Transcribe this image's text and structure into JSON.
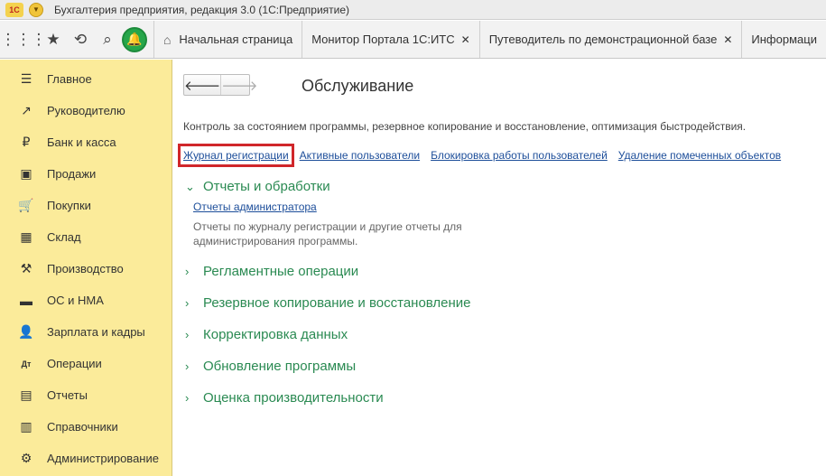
{
  "window": {
    "logo_text": "1С",
    "title": "Бухгалтерия предприятия, редакция 3.0  (1С:Предприятие)"
  },
  "tabs": [
    {
      "label": "Начальная страница"
    },
    {
      "label": "Монитор Портала 1С:ИТС",
      "close": "✕"
    },
    {
      "label": "Путеводитель по демонстрационной базе",
      "close": "✕"
    },
    {
      "label": "Информаци"
    }
  ],
  "sidebar": {
    "items": [
      {
        "label": "Главное",
        "icon": "☰"
      },
      {
        "label": "Руководителю",
        "icon": "↗"
      },
      {
        "label": "Банк и касса",
        "icon": "₽"
      },
      {
        "label": "Продажи",
        "icon": "▣"
      },
      {
        "label": "Покупки",
        "icon": "🛒"
      },
      {
        "label": "Склад",
        "icon": "▦"
      },
      {
        "label": "Производство",
        "icon": "⚒"
      },
      {
        "label": "ОС и НМА",
        "icon": "▬"
      },
      {
        "label": "Зарплата и кадры",
        "icon": "👤"
      },
      {
        "label": "Операции",
        "icon": "Дт"
      },
      {
        "label": "Отчеты",
        "icon": "▤"
      },
      {
        "label": "Справочники",
        "icon": "▥"
      },
      {
        "label": "Администрирование",
        "icon": "⚙"
      }
    ]
  },
  "main": {
    "back": "🡐",
    "forward": "🡒",
    "title": "Обслуживание",
    "description": "Контроль за состоянием программы, резервное копирование и восстановление, оптимизация быстродействия.",
    "links": [
      "Журнал регистрации",
      "Активные пользователи",
      "Блокировка работы пользователей",
      "Удаление помеченных объектов"
    ],
    "sections": [
      {
        "label": "Отчеты и обработки",
        "expanded": true
      },
      {
        "label": "Регламентные операции",
        "expanded": false
      },
      {
        "label": "Резервное копирование и восстановление",
        "expanded": false
      },
      {
        "label": "Корректировка данных",
        "expanded": false
      },
      {
        "label": "Обновление программы",
        "expanded": false
      },
      {
        "label": "Оценка производительности",
        "expanded": false
      }
    ],
    "admin_reports_link": "Отчеты администратора",
    "admin_reports_desc": "Отчеты по журналу регистрации и другие отчеты для администрирования программы."
  },
  "colors": {
    "sidebar_bg": "#fbeb9a",
    "section_green": "#2a8a52",
    "link_blue": "#1d4e9a",
    "highlight_red": "#d0262a"
  }
}
